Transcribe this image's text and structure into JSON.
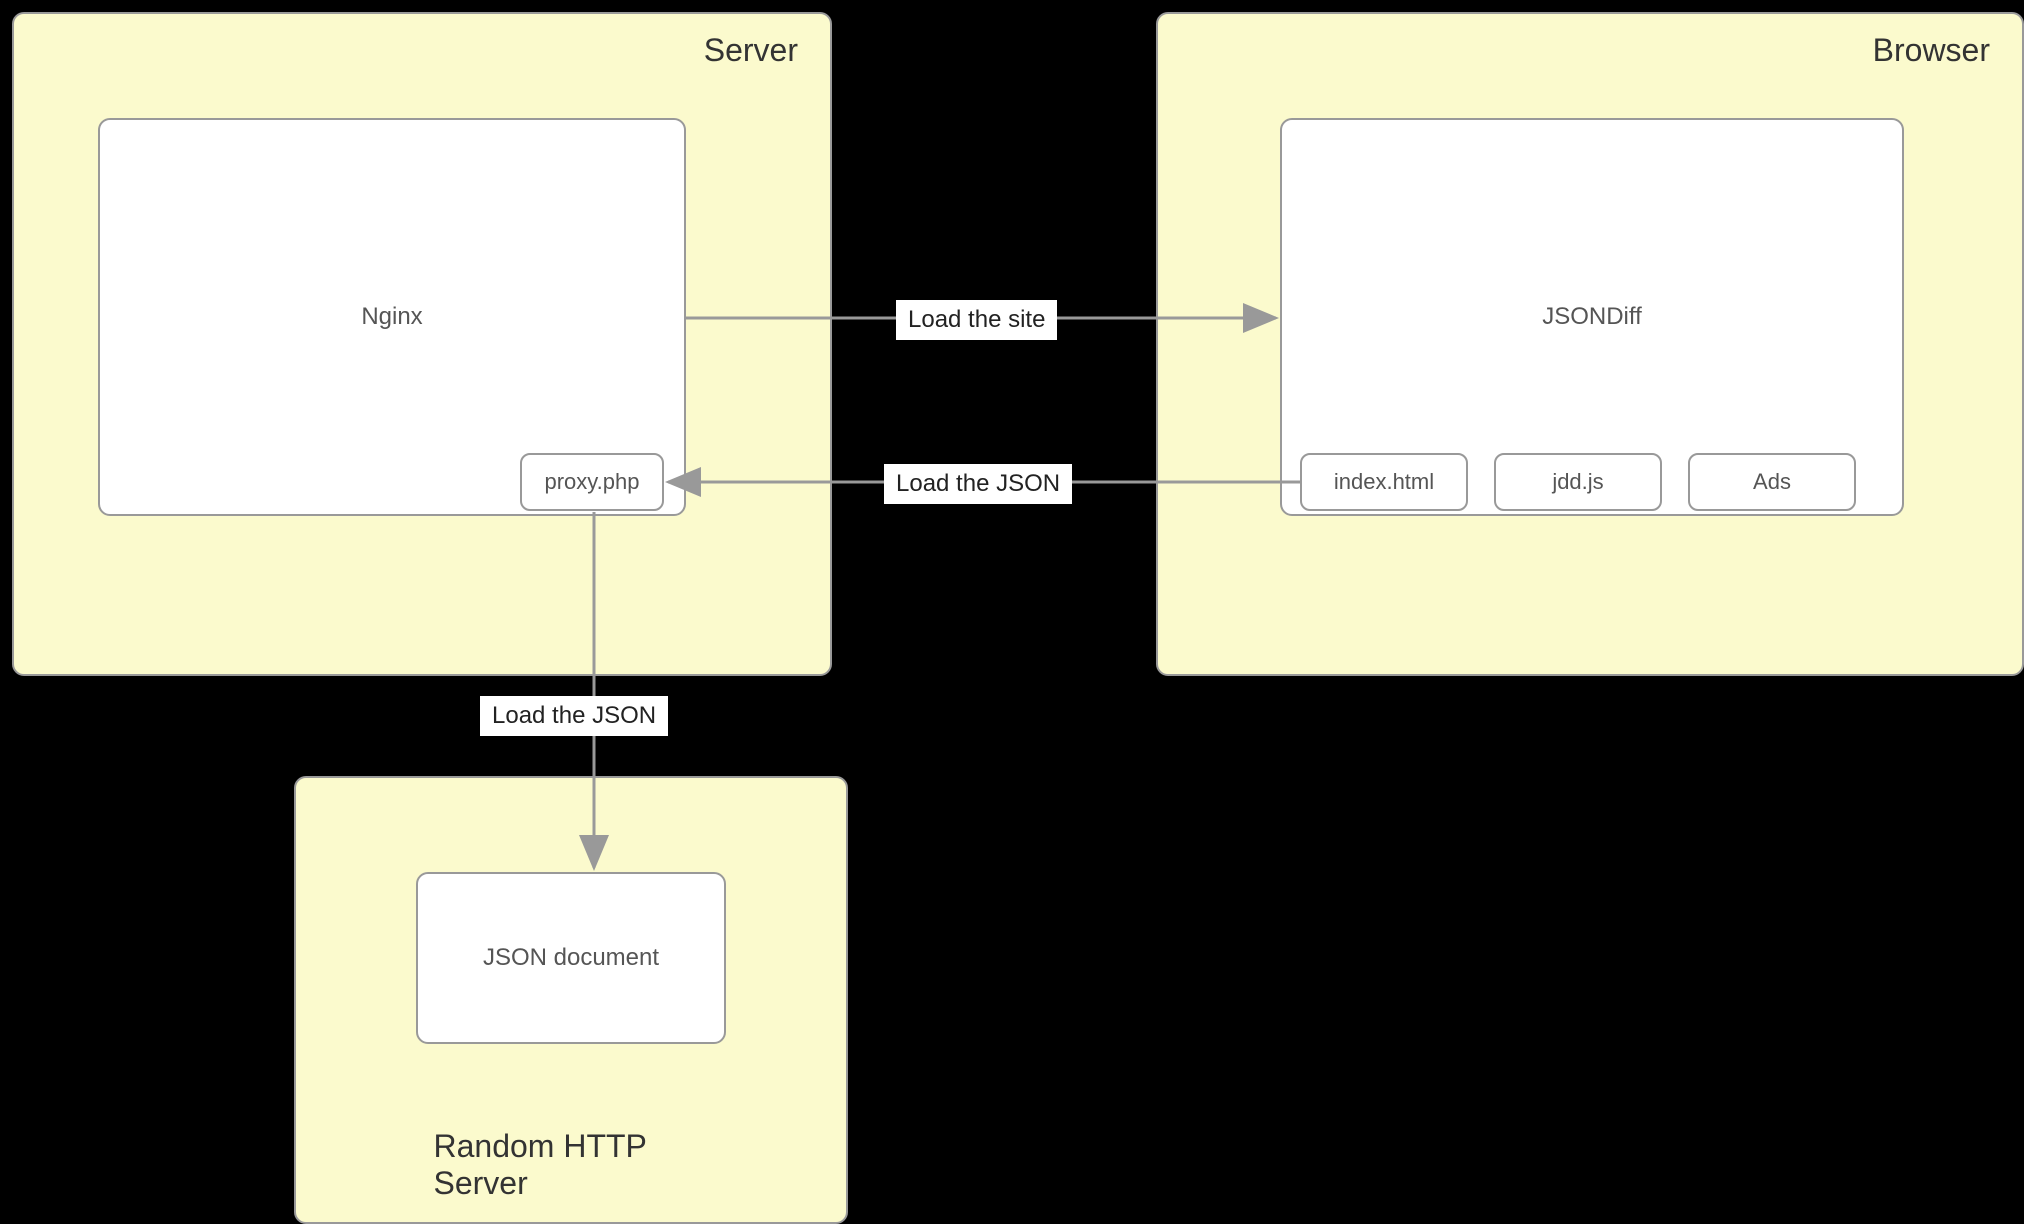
{
  "containers": {
    "server": {
      "title": "Server"
    },
    "browser": {
      "title": "Browser"
    },
    "random_http": {
      "title": "Random HTTP Server"
    }
  },
  "nodes": {
    "nginx": {
      "label": "Nginx"
    },
    "proxy_php": {
      "label": "proxy.php"
    },
    "jsondiff": {
      "label": "JSONDiff"
    },
    "index_html": {
      "label": "index.html"
    },
    "jdd_js": {
      "label": "jdd.js"
    },
    "ads": {
      "label": "Ads"
    },
    "json_document": {
      "label": "JSON document"
    }
  },
  "edges": {
    "load_site": {
      "label": "Load the site"
    },
    "load_json_1": {
      "label": "Load the JSON"
    },
    "load_json_2": {
      "label": "Load the JSON"
    }
  }
}
